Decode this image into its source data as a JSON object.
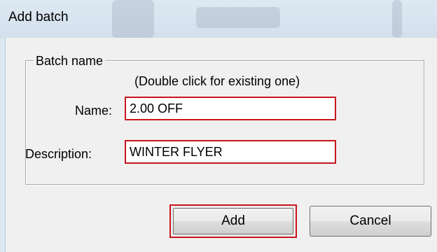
{
  "window": {
    "title": "Add batch"
  },
  "group": {
    "legend": "Batch name",
    "hint": "(Double click for existing one)"
  },
  "form": {
    "name_label": "Name:",
    "name_value": "2.00 OFF",
    "description_label": "Description:",
    "description_value": "WINTER FLYER"
  },
  "buttons": {
    "add_label": "Add",
    "cancel_label": "Cancel"
  },
  "colors": {
    "highlight": "#c8161d",
    "dialog_background": "#f0f0f0",
    "titlebar": "#d3e0ec"
  }
}
